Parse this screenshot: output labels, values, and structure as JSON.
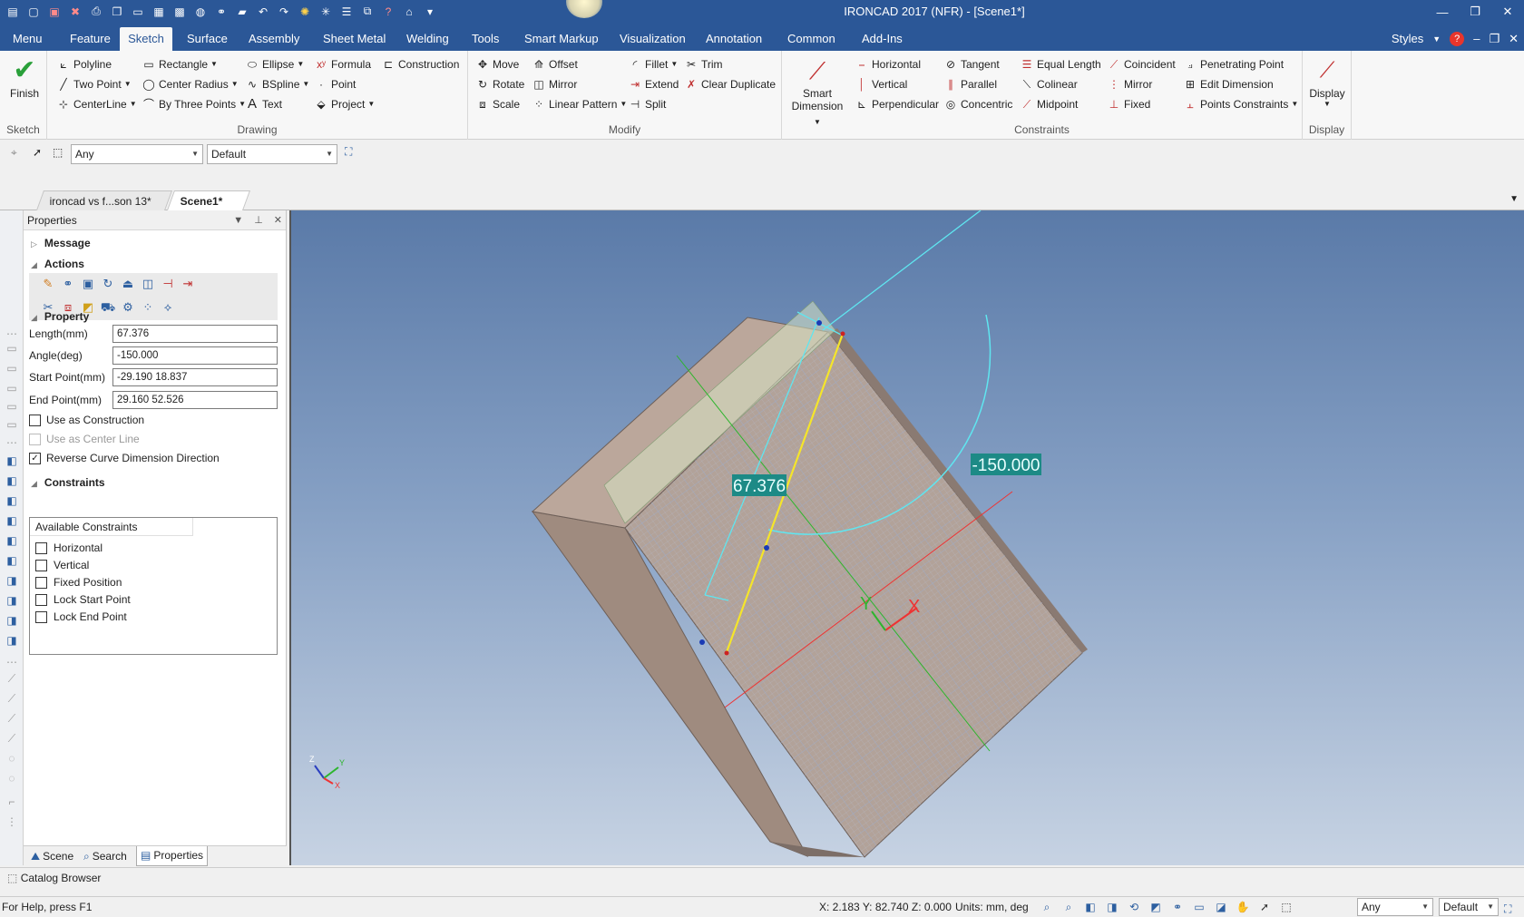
{
  "window": {
    "title": "IRONCAD 2017 (NFR) - [Scene1*]",
    "qat_icons": [
      "app-icon",
      "new-icon",
      "save-red-icon",
      "close-red-icon",
      "print-icon",
      "copy-icon",
      "open-icon",
      "save-icon",
      "image-icon",
      "catalog-icon",
      "link-icon",
      "folder-icon",
      "undo-icon",
      "redo-icon",
      "light-icon",
      "star-icon",
      "list-icon",
      "window-icon",
      "help-icon",
      "cap-icon",
      "more-icon"
    ]
  },
  "menu": {
    "tabs": [
      "Menu",
      "Feature",
      "Sketch",
      "Surface",
      "Assembly",
      "Sheet Metal",
      "Welding",
      "Tools",
      "Smart Markup",
      "Visualization",
      "Annotation",
      "Common",
      "Add-Ins"
    ],
    "active": "Sketch",
    "styles_label": "Styles"
  },
  "ribbon": {
    "sketch": {
      "finish": "Finish",
      "label": "Sketch"
    },
    "drawing": {
      "label": "Drawing",
      "polyline": "Polyline",
      "rectangle": "Rectangle",
      "ellipse": "Ellipse",
      "formula": "Formula",
      "construction": "Construction",
      "two_point": "Two Point",
      "center_radius": "Center Radius",
      "bspline": "BSpline",
      "point": "Point",
      "centerline": "CenterLine",
      "by_three_points": "By Three Points",
      "text": "Text",
      "project": "Project"
    },
    "modify": {
      "label": "Modify",
      "move": "Move",
      "offset": "Offset",
      "fillet": "Fillet",
      "trim": "Trim",
      "rotate": "Rotate",
      "mirror": "Mirror",
      "extend": "Extend",
      "clear_duplicate": "Clear Duplicate",
      "scale": "Scale",
      "linear_pattern": "Linear Pattern",
      "split": "Split"
    },
    "constraints": {
      "label": "Constraints",
      "smart_dimension_1": "Smart",
      "smart_dimension_2": "Dimension",
      "horizontal": "Horizontal",
      "tangent": "Tangent",
      "equal_length": "Equal Length",
      "coincident": "Coincident",
      "penetrating_point": "Penetrating Point",
      "vertical": "Vertical",
      "parallel": "Parallel",
      "colinear": "Colinear",
      "mirror": "Mirror",
      "edit_dimension": "Edit Dimension",
      "perpendicular": "Perpendicular",
      "concentric": "Concentric",
      "midpoint": "Midpoint",
      "fixed": "Fixed",
      "points_constraints": "Points Constraints"
    },
    "display": {
      "button": "Display",
      "label": "Display"
    }
  },
  "selection_bar": {
    "filter": "Any",
    "style": "Default"
  },
  "doc_tabs": [
    {
      "label": "ironcad vs f...son 13*",
      "active": false
    },
    {
      "label": "Scene1*",
      "active": true
    }
  ],
  "properties": {
    "title": "Properties",
    "sections": {
      "message": "Message",
      "actions": "Actions",
      "property": "Property",
      "constraints": "Constraints"
    },
    "fields": {
      "length_label": "Length(mm)",
      "length_value": "67.376",
      "angle_label": "Angle(deg)",
      "angle_value": "-150.000",
      "start_label": "Start Point(mm)",
      "start_value": "-29.190 18.837",
      "end_label": "End Point(mm)",
      "end_value": "29.160 52.526"
    },
    "checks": {
      "use_as_construction": "Use as Construction",
      "use_as_center_line": "Use as Center Line",
      "reverse_curve": "Reverse Curve Dimension Direction"
    },
    "constraints_header": "Available Constraints",
    "constraint_items": [
      "Horizontal",
      "Vertical",
      "Fixed Position",
      "Lock Start Point",
      "Lock End Point"
    ],
    "bottom_tabs": [
      "Scene",
      "Search",
      "Properties"
    ]
  },
  "viewport": {
    "length_dim": "67.376",
    "angle_dim": "-150.000",
    "axis_x": "X",
    "axis_y": "Y",
    "triad_x": "X",
    "triad_y": "Y",
    "triad_z": "Z"
  },
  "catalog_browser": "Catalog Browser",
  "status": {
    "help": "For Help, press F1",
    "coords": "X: 2.183 Y: 82.740 Z: 0.000",
    "units": "Units: mm, deg",
    "filter": "Any",
    "style": "Default"
  }
}
